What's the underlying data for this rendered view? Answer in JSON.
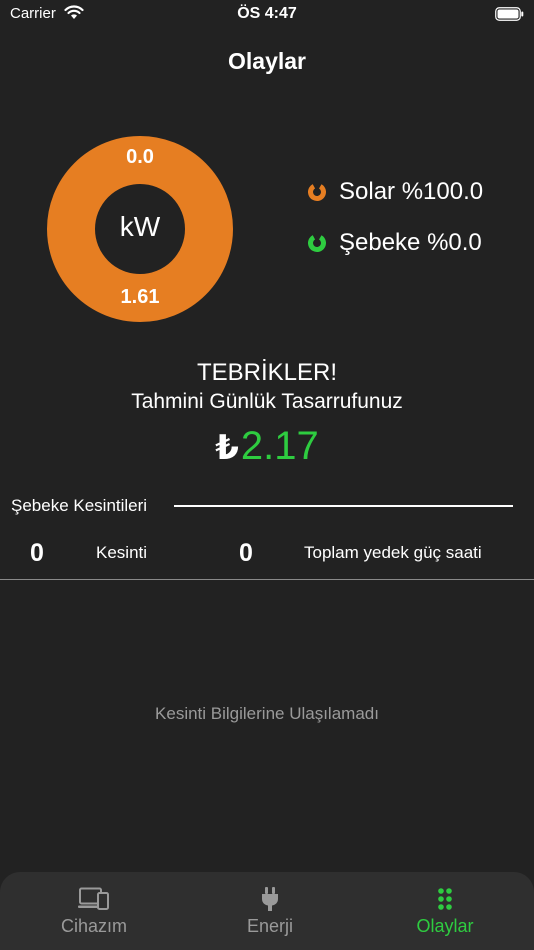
{
  "status_bar": {
    "carrier": "Carrier",
    "time": "ÖS 4:47"
  },
  "header": {
    "title": "Olaylar"
  },
  "energy_mix": {
    "top_value": "0.0",
    "bottom_value": "1.61",
    "unit": "kW",
    "ring_color": "#E67E22",
    "legend": [
      {
        "label": "Solar %100.0",
        "color": "#E67E22",
        "icon": "donut-icon"
      },
      {
        "label": "Şebeke %0.0",
        "color": "#2ECC40",
        "icon": "donut-icon"
      }
    ]
  },
  "savings": {
    "congrats": "TEBRİKLER!",
    "label": "Tahmini Günlük Tasarrufunuz",
    "currency": "₺",
    "value": "2.17",
    "value_color": "#2ECC40"
  },
  "outages": {
    "section_title": "Şebeke Kesintileri",
    "count": "0",
    "count_label": "Kesinti",
    "backup_hours": "0",
    "backup_label": "Toplam yedek güç saati",
    "empty_message": "Kesinti Bilgilerine Ulaşılamadı"
  },
  "tab_bar": {
    "tabs": [
      {
        "label": "Cihazım",
        "icon": "devices-icon",
        "active": false
      },
      {
        "label": "Enerji",
        "icon": "plug-icon",
        "active": false
      },
      {
        "label": "Olaylar",
        "icon": "dots-grid-icon",
        "active": true
      }
    ],
    "active_color": "#2ECC40"
  }
}
